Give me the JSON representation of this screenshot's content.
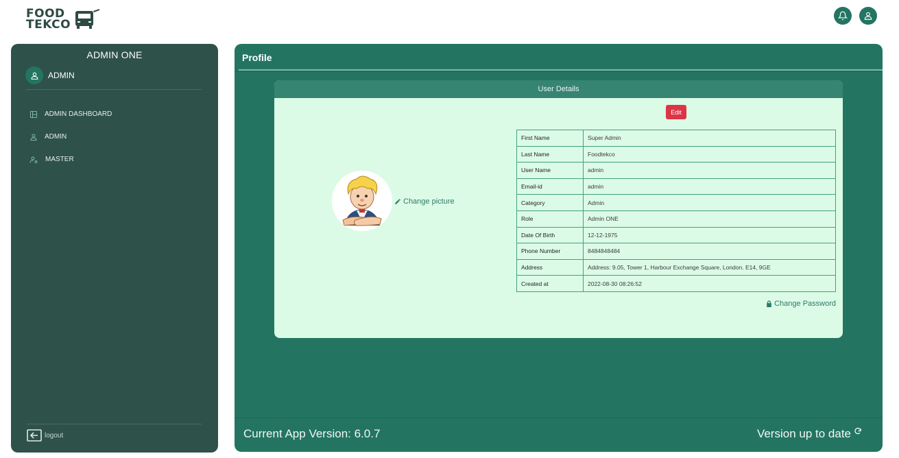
{
  "brand": {
    "line1": "FOOD",
    "line2": "TEKCO"
  },
  "topbar": {
    "notification_icon": "bell-icon",
    "user_icon": "user-icon"
  },
  "sidebar": {
    "title": "ADMIN ONE",
    "user_label": "ADMIN",
    "items": [
      {
        "label": "ADMIN DASHBOARD",
        "icon": "layout-icon"
      },
      {
        "label": "ADMIN",
        "icon": "user-icon"
      },
      {
        "label": "MASTER",
        "icon": "user-settings-icon"
      }
    ],
    "logout_label": "logout"
  },
  "main": {
    "title": "Profile",
    "card_header": "User Details",
    "edit_label": "Edit",
    "change_picture_label": "Change picture",
    "change_password_label": "Change Password",
    "details": [
      {
        "key": "First Name",
        "value": "Super Admin"
      },
      {
        "key": "Last Name",
        "value": "Foodtekco"
      },
      {
        "key": "User Name",
        "value": "admin"
      },
      {
        "key": "Email-id",
        "value": "admin"
      },
      {
        "key": "Category",
        "value": "Admin"
      },
      {
        "key": "Role",
        "value": "Admin ONE"
      },
      {
        "key": "Date Of Birth",
        "value": "12-12-1975"
      },
      {
        "key": "Phone Number",
        "value": "8484848484"
      },
      {
        "key": "Address",
        "value": "Address: 9.05, Tower 1, Harbour Exchange Square, London. E14, 9GE"
      },
      {
        "key": "Created at",
        "value": "2022-08-30 08:26:52"
      }
    ],
    "version_label": "Current App Version: 6.0.7",
    "status_label": "Version up to date"
  },
  "colors": {
    "primary": "#237562",
    "sidebar": "#2e5149",
    "card": "#dcfbe6",
    "edit": "#dc3545"
  }
}
